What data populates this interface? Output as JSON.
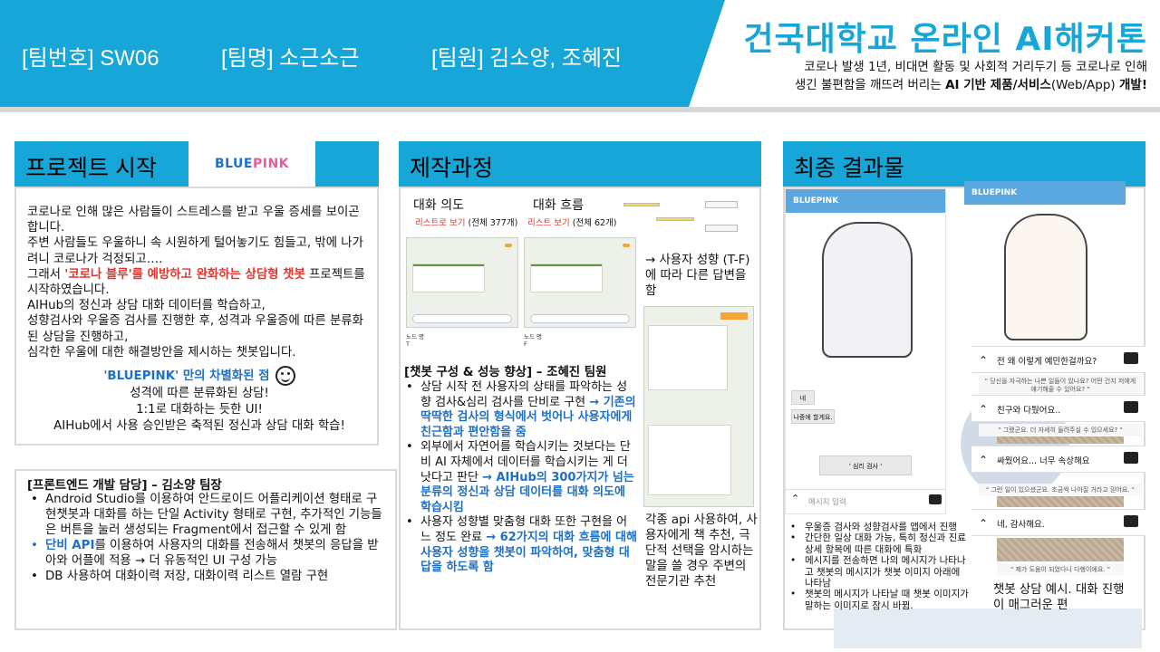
{
  "header": {
    "team_no": "[팀번호] SW06",
    "team_name": "[팀명] 소근소근",
    "members": "[팀원] 김소양, 조혜진",
    "hackathon_title": "건국대학교 온라인 AI해커톤",
    "desc_1": "코로나 발생 1년, 비대면 활동 및 사회적 거리두기 등 코로나로 인해",
    "desc_2": "생긴 불편함을 깨뜨려 버리는",
    "desc_bold1": "AI 기반 제품/서비스",
    "desc_3": "(Web/App)",
    "desc_bold2": "개발!"
  },
  "colors": {
    "accent": "#16a6d8",
    "highlight_red": "#e8332a",
    "highlight_blue": "#1e6fc7",
    "logo_pink": "#e85aa0"
  },
  "project_start": {
    "title": "프로젝트 시작",
    "logo_blue": "BLUE",
    "logo_pink": "PINK",
    "para_1": "코로나로 인해 많은 사람들이 스트레스를 받고 우울 증세를 보이곤 합니다.",
    "para_2": "주변 사람들도 우울하니 속 시원하게 털어놓기도 힘들고, 밖에 나가려니 코로나가 걱정되고….",
    "para_3a": "그래서 ",
    "para_3_red": "'코로나 블루'를 예방하고 완화하는 상담형 챗봇",
    "para_3b": " 프로젝트를 시작하였습니다.",
    "para_4": "AIHub의 정신과 상담 대화 데이터를 학습하고,",
    "para_5": "성향검사와 우울증 검사를 진행한 후, 성격과 우울증에 따른 분류화된 상담을 진행하고,",
    "para_6": "심각한 우울에 대한 해결방안을 제시하는 챗봇입니다.",
    "feature_title": "'BLUEPINK' 만의 차별화된 점",
    "feature_1": "성격에 따른 분류화된 상담!",
    "feature_2": "1:1로 대화하는 듯한 UI!",
    "feature_3": "AIHub에서 사용 승인받은 축적된 정신과 상담 대화 학습!"
  },
  "frontend": {
    "title": "[프론트엔드 개발 담당] – 김소양 팀장",
    "item_1": "Android Studio를 이용하여 안드로이드 어플리케이션 형태로 구현챗봇과 대화를 하는 단일 Activity 형태로 구현, 추가적인 기능들은 버튼을 눌러 생성되는 Fragment에서 접근할 수 있게 함",
    "item_2_blue": "단비 API",
    "item_2": "를 이용하여 사용자의 대화를 전송해서 챗봇의 응답을 받아와 어플에 적용 → 더 유동적인 UI 구성 가능",
    "item_3": "DB 사용하여 대화이력 저장, 대화이력 리스트 열람 구현"
  },
  "process": {
    "title": "제작과정",
    "intent_label": "대화 의도",
    "flow_label": "대화 흐름",
    "intent_list": "리스트로 보기",
    "intent_count": "(전체 377개)",
    "flow_list": "리스트 보기",
    "flow_count": "(전체 62개)",
    "node_t": "노드 명",
    "node_t_val": "T",
    "node_f": "노드 명",
    "node_f_val": "F",
    "tendency_note": "→ 사용자 성향 (T-F)에 따라 다른 답변을 함",
    "chatbot_title": "[챗봇 구성 & 성능 향상] – 조혜진 팀원",
    "cb_1": "상담 시작 전 사용자의 상태를 파악하는 성향 검사&심리 검사를 단비로 구현",
    "cb_1_blue": "→ 기존의 딱딱한 검사의 형식에서 벗어나 사용자에게 친근함과 편안함을 줌",
    "cb_2": "외부에서 자연어를 학습시키는 것보다는 단비 AI 자체에서 데이터를 학습시키는 게 더 낫다고 판단",
    "cb_2_blue": "→ AIHub의 300가지가 넘는 분류의 정신과 상담 데이터를 대화 의도에 학습시킴",
    "cb_3": "사용자 성향별 맞춤형 대화 또한 구현을 어느 정도 완료",
    "cb_3_blue": "→ 62가지의 대화 흐름에 대해 사용자 성향을 챗봇이 파악하여, 맞춤형 대답을 하도록 함",
    "api_note": "각종 api 사용하여, 사용자에게 책 추천, 극단적 선택을 암시하는 말을 쓸 경우 주변의 전문기관 추천"
  },
  "result": {
    "title": "최종 결과물",
    "app_name_1": "BLUEPINK",
    "app_name_2": "BLUEPINK",
    "btn_1": "네",
    "btn_2": "나중에 할게요.",
    "btn_3": "' 심리 검사 '",
    "input_placeholder": "메시지 입력",
    "chat_1": "전 왜 이렇게 예민한걸까요?",
    "chat_2": "친구와 다퉜어요..",
    "chat_3": "싸웠어요... 너무 속상해요",
    "chat_4": "네, 감사해요.",
    "quote_1": "\" 당신을 자극하는 나쁜 일들이 있나요? 어떤 건지 저에게 얘기해줄 수 있어요? \"",
    "quote_2": "\" 그랬군요. 더 자세히 들려주실 수 있으세요? \"",
    "quote_3": "\" 그런 일이 있으셨군요. 조금씩 나아질 거라고 믿어요. \"",
    "quote_4": "\" 제가 도움이 되었다니 다행이에요. \"",
    "r_1": "우울증 검사와 성향검사를 앱에서 진행",
    "r_2": "간단한 일상 대화 가능, 특히 정신과 진료 상세 항목에 따른 대화에 특화",
    "r_3": "메시지를 전송하면 나의 메시지가 나타나고 챗봇의 메시지가 챗봇 이미지 아래에 나타남",
    "r_4": "챗봇의 메시지가 나타날 때 챗봇 이미지가 말하는 이미지로 잠시 바뀜.",
    "example_note": "챗봇 상담 예시. 대화 진행이 매그러운 편"
  }
}
